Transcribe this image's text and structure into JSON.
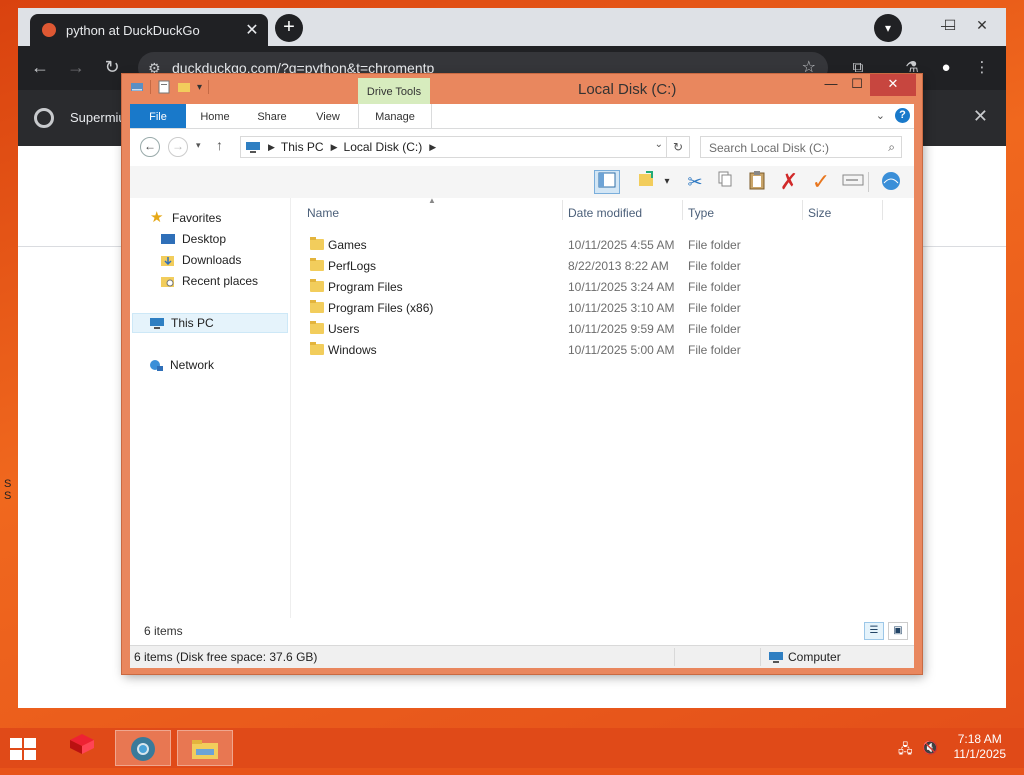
{
  "browser": {
    "tab_title": "python at DuckDuckGo",
    "tab_close": "✕",
    "new_tab": "+",
    "minimize": "—",
    "maximize": "☐",
    "close": "✕",
    "url": "duckduckgo.com/?q=python&t=chromentp",
    "infobar_text": "Supermiu",
    "infobar_close": "✕",
    "desktop_left_text_1": "S",
    "desktop_left_text_2": "S"
  },
  "explorer": {
    "title": "Local Disk (C:)",
    "contextual_tab": "Drive Tools",
    "ribbon_tabs": [
      "File",
      "Home",
      "Share",
      "View",
      "Manage"
    ],
    "help": "?",
    "breadcrumb": [
      "This PC",
      "Local Disk (C:)"
    ],
    "search_placeholder": "Search Local Disk (C:)",
    "nav": {
      "favorites": "Favorites",
      "desktop": "Desktop",
      "downloads": "Downloads",
      "recent": "Recent places",
      "this_pc": "This PC",
      "network": "Network"
    },
    "columns": {
      "name": "Name",
      "date": "Date modified",
      "type": "Type",
      "size": "Size"
    },
    "files": [
      {
        "name": "Games",
        "date": "10/11/2025 4:55 AM",
        "type": "File folder"
      },
      {
        "name": "PerfLogs",
        "date": "8/22/2013 8:22 AM",
        "type": "File folder"
      },
      {
        "name": "Program Files",
        "date": "10/11/2025 3:24 AM",
        "type": "File folder"
      },
      {
        "name": "Program Files (x86)",
        "date": "10/11/2025 3:10 AM",
        "type": "File folder"
      },
      {
        "name": "Users",
        "date": "10/11/2025 9:59 AM",
        "type": "File folder"
      },
      {
        "name": "Windows",
        "date": "10/11/2025 5:00 AM",
        "type": "File folder"
      }
    ],
    "item_count": "6 items",
    "status_left": "6 items (Disk free space: 37.6 GB)",
    "status_right": "Computer",
    "window_minimize": "—",
    "window_maximize": "☐",
    "window_close": "✕"
  },
  "taskbar": {
    "time": "7:18 AM",
    "date": "11/1/2025"
  },
  "colors": {
    "desktop": "#e8541a",
    "explorer_frame": "#e9875e",
    "file_tab": "#1979ca",
    "drive_tools": "#d7ecbe",
    "close_button": "#c7463f"
  }
}
